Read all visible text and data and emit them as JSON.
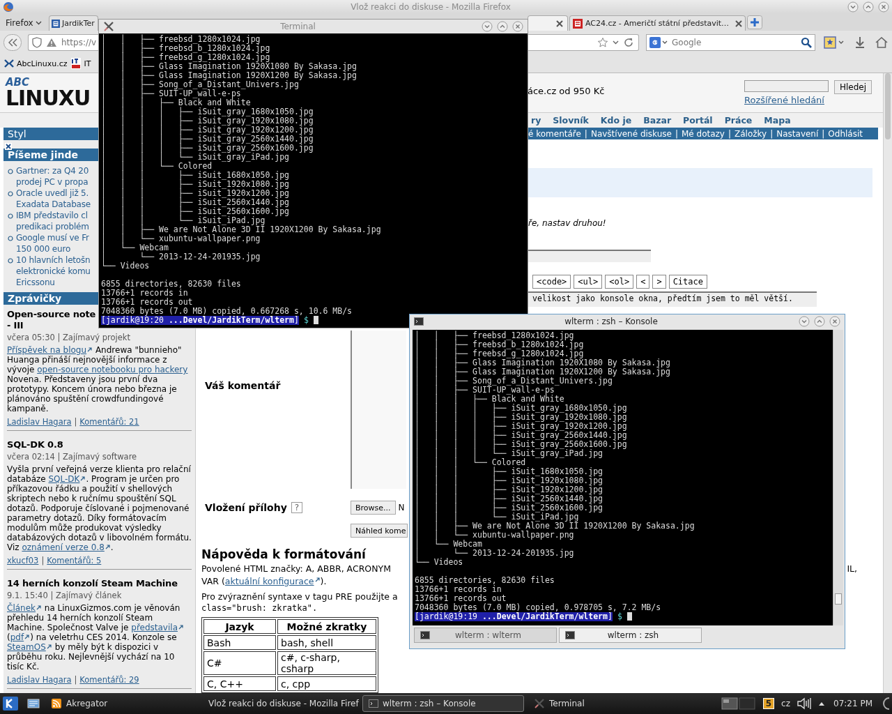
{
  "firefox": {
    "title": "Vlož reakci do diskuse - Mozilla Firefox",
    "menu_button": "Firefox",
    "tabs": [
      {
        "label": "JardikTer",
        "selected": false
      },
      {
        "selected": true
      },
      {
        "label": "AC24.cz - Američtí státní představit…",
        "selected": false
      }
    ],
    "url": "https://v",
    "search": {
      "placeholder": "Google"
    },
    "bookmarks": [
      "AbcLinuxu.cz",
      "IT"
    ]
  },
  "page": {
    "logo": {
      "top": "ABC",
      "bottom": "LINUXU"
    },
    "ad": "áce.cz od 950 Kč",
    "search_button": "Hledej",
    "advanced_search": "Rozšířené hledání",
    "nav": [
      "ry",
      "Slovník",
      "Kdo je",
      "Bazar",
      "Portál",
      "Práce",
      "Mapa"
    ],
    "user_links": [
      "é komentáře",
      "Navštívené diskuse",
      "Mé dotazy",
      "Záložky",
      "Nastavení",
      "Odhlásit"
    ],
    "separator": "|",
    "notice": "ře, nastav druhou!",
    "format_buttons": [
      "<code>",
      "<ul>",
      "<ol>",
      "<",
      ">",
      "Citace"
    ],
    "comment_text": "velikost jako konsole okna, předtím jsem to měl větší.",
    "sidebar": {
      "style_heading": "Styl",
      "elsewhere_heading": "Píšeme jinde",
      "elsewhere": [
        [
          "Gartner: za Q4 20",
          "prodej PC v propa"
        ],
        [
          "Oracle uvedl již 5.",
          "Exadata Database"
        ],
        [
          "IBM představilo cl",
          "predikaci problém"
        ],
        [
          "Google musí ve Fr",
          "150 000 euro"
        ],
        [
          "10 hlavních letošn",
          "elektronické komu",
          "Ericssonu"
        ]
      ],
      "news_heading": "Zprávičky",
      "news": [
        {
          "title_lines": [
            "Open-source note",
            "- III"
          ],
          "meta": "včera 05:30 | Zajímavý projekt",
          "body": [
            {
              "kind": "external_link",
              "text": "Příspěvek na blogu"
            },
            {
              "kind": "text",
              "text": " Andrewa \"bunnieho\" Huanga přináší nejnovější informace z vývoje "
            },
            {
              "kind": "link",
              "text": "open-source notebooku pro hackery"
            },
            {
              "kind": "text",
              "text": " Novena. Představeny jsou první dva prototypy. Koncem února nebo března je plánováno spuštění crowdfundingové kampaně."
            }
          ],
          "author": "Ladislav Hagara",
          "comments": "Komentářů: 21"
        },
        {
          "title_lines": [
            "SQL-DK 0.8"
          ],
          "meta": "včera 02:14 | Zajímavý software",
          "body": [
            {
              "kind": "text",
              "text": "Vyšla první veřejná verze klienta pro relační databáze "
            },
            {
              "kind": "external_link",
              "text": "SQL-DK"
            },
            {
              "kind": "text",
              "text": ". Program je určen pro příkazovou řádku a použití v shellových skriptech nebo k ručnímu spouštění SQL dotazů. Podporuje číslované i pojmenované parametry dotazů. Díky formátovacím modulům může produkovat výsledky databázových dotazů v libovolném formátu. Viz "
            },
            {
              "kind": "external_link",
              "text": "oznámení verze 0.8"
            },
            {
              "kind": "text",
              "text": "."
            }
          ],
          "author": "xkucf03",
          "comments": "Komentářů: 5"
        },
        {
          "title_lines": [
            "14 herních konzolí Steam Machine"
          ],
          "meta": "9.1. 15:40 | Zajímavý článek",
          "body": [
            {
              "kind": "external_link",
              "text": "Článek"
            },
            {
              "kind": "text",
              "text": " na LinuxGizmos.com je věnován přehledu 14 herních konzolí Steam Machine. Společnost Valve je "
            },
            {
              "kind": "external_link",
              "text": "představila"
            },
            {
              "kind": "text",
              "text": " ("
            },
            {
              "kind": "external_link",
              "text": "pdf"
            },
            {
              "kind": "text",
              "text": ") na veletrhu CES 2014. Konzole se "
            },
            {
              "kind": "external_link",
              "text": "SteamOS"
            },
            {
              "kind": "text",
              "text": " by měly být k dispozici v průběhu roku. Nejlevnější vychází na 10 tisíc Kč."
            }
          ],
          "author": "Ladislav Hagara",
          "comments": "Komentářů: 29"
        }
      ]
    },
    "comment_label": "Váš komentář",
    "attach_label": "Vložení přílohy",
    "help_mark": "?",
    "browse_button": "Browse...",
    "file_status": "N",
    "preview_button": "Náhled kome",
    "help_heading": "Nápověda k formátování",
    "allowed_tags": "Povolené HTML značky: A, ABBR, ACRONYM",
    "allowed_tags_end": "IL,",
    "config_line": [
      {
        "kind": "text",
        "text": "VAR ("
      },
      {
        "kind": "external_link",
        "text": "aktuální konfigurace"
      },
      {
        "kind": "text",
        "text": ")."
      }
    ],
    "syntax_line": "Pro zvýraznění syntaxe v tagu PRE použijte a",
    "syntax_code": "class=\"brush: zkratka\".",
    "table": {
      "columns": [
        "Jazyk",
        "Možné zkratky"
      ],
      "rows": [
        [
          "Bash",
          "bash, shell"
        ],
        [
          "C#",
          "c#, c-sharp, csharp"
        ],
        [
          "C, C++",
          "c, cpp"
        ]
      ]
    }
  },
  "terminal": {
    "title": "Terminal",
    "lines": [
      "│   │   ├── freebsd_1280x1024.jpg",
      "│   │   ├── freebsd_b_1280x1024.jpg",
      "│   │   ├── freebsd_g_1280x1024.jpg",
      "│   │   ├── Glass Imagination 1920X1080 By Sakasa.jpg",
      "│   │   ├── Glass Imagination 1920X1200 By Sakasa.jpg",
      "│   │   ├── Song_of_a_Distant_Univers.jpg",
      "│   │   ├── SUIT-UP_wall-e-ps",
      "│   │   │   ├── Black and White",
      "│   │   │   │   ├── iSuit_gray_1680x1050.jpg",
      "│   │   │   │   ├── iSuit_gray_1920x1080.jpg",
      "│   │   │   │   ├── iSuit_gray_1920x1200.jpg",
      "│   │   │   │   ├── iSuit_gray_2560x1440.jpg",
      "│   │   │   │   ├── iSuit_gray_2560x1600.jpg",
      "│   │   │   │   └── iSuit_gray_iPad.jpg",
      "│   │   │   └── Colored",
      "│   │   │       ├── iSuit_1680x1050.jpg",
      "│   │   │       ├── iSuit_1920x1080.jpg",
      "│   │   │       ├── iSuit_1920x1200.jpg",
      "│   │   │       ├── iSuit_2560x1440.jpg",
      "│   │   │       ├── iSuit_2560x1600.jpg",
      "│   │   │       └── iSuit_iPad.jpg",
      "│   │   ├── We are Not Alone 3D II 1920X1200 By Sakasa.jpg",
      "│   │   └── xubuntu-wallpaper.png",
      "│   └── Webcam",
      "│       └── 2013-12-24-201935.jpg",
      "└── Videos"
    ],
    "summary": [
      "6855 directories, 82630 files",
      "13766+1 records in",
      "13766+1 records out",
      "7048360 bytes (7.0 MB) copied, 0.667268 s, 10.6 MB/s"
    ],
    "prompt": "[jardik@19:20 **...Devel/JardikTerm/wlterm**]",
    "prompt_symbol": "$"
  },
  "konsole": {
    "title": "wlterm : zsh – Konsole",
    "lines": [
      "│   │   ├── freebsd_1280x1024.jpg",
      "│   │   ├── freebsd_b_1280x1024.jpg",
      "│   │   ├── freebsd_g_1280x1024.jpg",
      "│   │   ├── Glass Imagination 1920X1080 By Sakasa.jpg",
      "│   │   ├── Glass Imagination 1920X1200 By Sakasa.jpg",
      "│   │   ├── Song_of_a_Distant_Univers.jpg",
      "│   │   ├── SUIT-UP_wall-e-ps",
      "│   │   │   ├── Black and White",
      "│   │   │   │   ├── iSuit_gray_1680x1050.jpg",
      "│   │   │   │   ├── iSuit_gray_1920x1080.jpg",
      "│   │   │   │   ├── iSuit_gray_1920x1200.jpg",
      "│   │   │   │   ├── iSuit_gray_2560x1440.jpg",
      "│   │   │   │   ├── iSuit_gray_2560x1600.jpg",
      "│   │   │   │   └── iSuit_gray_iPad.jpg",
      "│   │   │   └── Colored",
      "│   │   │       ├── iSuit_1680x1050.jpg",
      "│   │   │       ├── iSuit_1920x1080.jpg",
      "│   │   │       ├── iSuit_1920x1200.jpg",
      "│   │   │       ├── iSuit_2560x1440.jpg",
      "│   │   │       ├── iSuit_2560x1600.jpg",
      "│   │   │       └── iSuit_iPad.jpg",
      "│   │   ├── We are Not Alone 3D II 1920X1200 By Sakasa.jpg",
      "│   │   └── xubuntu-wallpaper.png",
      "│   └── Webcam",
      "│       └── 2013-12-24-201935.jpg",
      "└── Videos"
    ],
    "summary": [
      "6855 directories, 82630 files",
      "13766+1 records in",
      "13766+1 records out",
      "7048360 bytes (7.0 MB) copied, 0.978705 s, 7.2 MB/s"
    ],
    "prompt": "[jardik@19:19 **...Devel/JardikTerm/wlterm**]",
    "prompt_symbol": "$",
    "tabs": [
      {
        "label": "wlterm : wlterm",
        "selected": false
      },
      {
        "label": "wlterm : zsh",
        "selected": true
      }
    ]
  },
  "taskbar": {
    "items": [
      {
        "kind": "feed",
        "label": "Akregator",
        "selected": false
      },
      {
        "kind": "browser",
        "label": "Vlož reakci do diskuse - Mozilla Firef",
        "selected": false
      },
      {
        "kind": "terminal",
        "label": "wlterm : zsh – Konsole",
        "selected": true
      },
      {
        "kind": "x",
        "label": "Terminal",
        "selected": false
      }
    ],
    "tray": {
      "badge": "5",
      "layout": "cz",
      "clock": "07:21 PM"
    }
  }
}
